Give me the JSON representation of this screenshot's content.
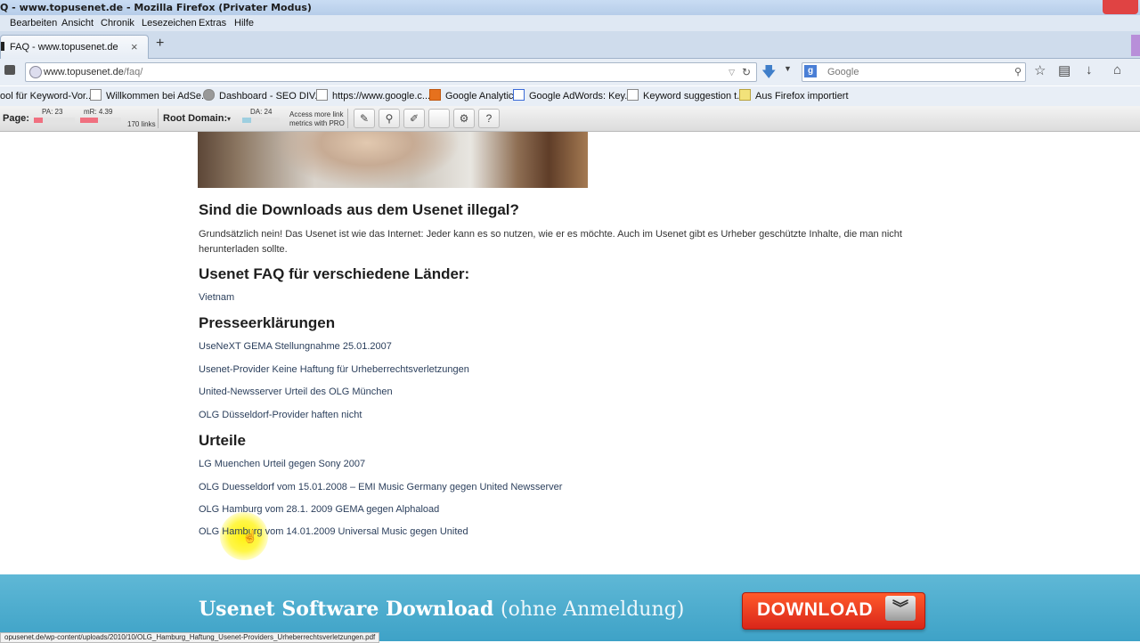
{
  "window": {
    "title": "Q - www.topusenet.de - Mozilla Firefox (Privater Modus)"
  },
  "menu": [
    "Bearbeiten",
    "Ansicht",
    "Chronik",
    "Lesezeichen",
    "Extras",
    "Hilfe"
  ],
  "tab": {
    "label": "FAQ - www.topusenet.de",
    "close": "×",
    "new": "+"
  },
  "urlbar": {
    "host": "www.topusenet.de",
    "path": "/faq/"
  },
  "search": {
    "placeholder": "Google"
  },
  "bookmarks": [
    "ool für Keyword-Vor...",
    "Willkommen bei AdSe...",
    "Dashboard - SEO DIV...",
    "https://www.google.c...",
    "Google Analytics",
    "Google AdWords: Key...",
    "Keyword suggestion t...",
    "Aus Firefox importiert"
  ],
  "mozbar": {
    "page_label": "Page:",
    "pa": "PA: 23",
    "mr": "mR: 4.39",
    "links": "170 links",
    "root_label": "Root Domain:",
    "da": "DA: 24",
    "pro_line1": "Access more link",
    "pro_line2": "metrics with PRO"
  },
  "content": {
    "h_illegal": "Sind die Downloads aus dem Usenet illegal?",
    "p_illegal": "Grundsätzlich nein! Das Usenet ist wie das Internet: Jeder kann es so nutzen, wie er es möchte. Auch im Usenet gibt es Urheber geschützte Inhalte, die man nicht herunterladen sollte.",
    "h_laender": "Usenet FAQ für verschiedene Länder:",
    "laender_links": [
      "Vietnam"
    ],
    "h_presse": "Presseerklärungen",
    "presse_links": [
      "UseNeXT GEMA Stellungnahme 25.01.2007",
      "Usenet-Provider Keine Haftung für Urheberrechtsverletzungen",
      "United-Newsserver Urteil des OLG München",
      "OLG Düsseldorf-Provider haften nicht"
    ],
    "h_urteile": "Urteile",
    "urteile_links": [
      "LG Muenchen Urteil gegen Sony 2007",
      "OLG Duesseldorf vom 15.01.2008 – EMI Music Germany gegen United Newsserver",
      "OLG Hamburg vom 28.1. 2009 GEMA gegen Alphaload",
      "OLG Hamburg vom 14.01.2009 Universal Music gegen United"
    ]
  },
  "banner": {
    "title": "Usenet Software Download",
    "subtitle": "(ohne Anmeldung)",
    "button": "DOWNLOAD",
    "button_icon": "double-chevron-down-icon",
    "color": "#3ea2c7",
    "button_color": "#e8331f"
  },
  "status": {
    "url": "opusenet.de/wp-content/uploads/2010/10/OLG_Hamburg_Haftung_Usenet-Providers_Urheberrechtsverletzungen.pdf"
  }
}
